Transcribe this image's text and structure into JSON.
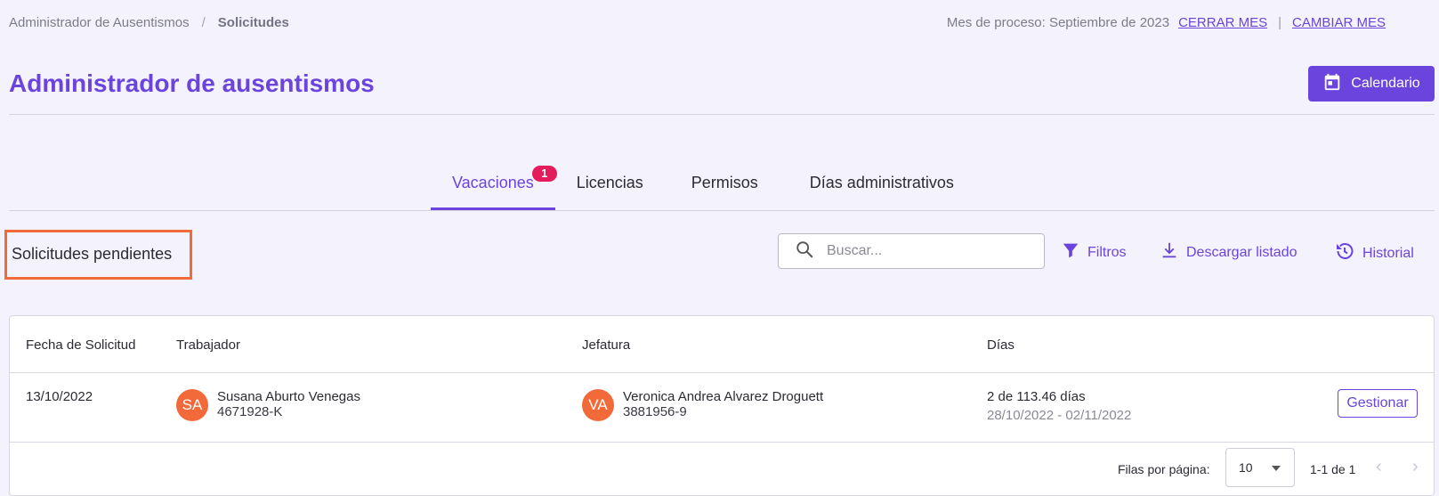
{
  "breadcrumb": {
    "parent": "Administrador de Ausentismos",
    "separator": "/",
    "current": "Solicitudes"
  },
  "process": {
    "label": "Mes de proceso: Septiembre de 2023",
    "close_month": "CERRAR MES",
    "change_month": "CAMBIAR MES"
  },
  "page": {
    "title": "Administrador de ausentismos",
    "calendar_button": "Calendario"
  },
  "tabs": [
    {
      "label": "Vacaciones",
      "badge": "1",
      "active": true
    },
    {
      "label": "Licencias"
    },
    {
      "label": "Permisos"
    },
    {
      "label": "Días administrativos"
    }
  ],
  "section": {
    "title": "Solicitudes pendientes"
  },
  "toolbar": {
    "search_placeholder": "Buscar...",
    "filters": "Filtros",
    "download": "Descargar listado",
    "history": "Historial"
  },
  "table": {
    "headers": [
      "Fecha de Solicitud",
      "Trabajador",
      "Jefatura",
      "Días"
    ],
    "rows": [
      {
        "date": "13/10/2022",
        "worker": {
          "initials": "SA",
          "name": "Susana Aburto Venegas",
          "id": "4671928-K"
        },
        "boss": {
          "initials": "VA",
          "name": "Veronica Andrea Alvarez Droguett",
          "id": "3881956-9"
        },
        "days": "2 de 113.46 días",
        "range": "28/10/2022 - 02/11/2022",
        "action": "Gestionar"
      }
    ]
  },
  "pagination": {
    "rows_per_page_label": "Filas por página:",
    "rows_per_page": "10",
    "range": "1-1 de 1"
  },
  "colors": {
    "accent": "#6a44dc",
    "badge": "#e41c5c",
    "avatar": "#f26a3a",
    "highlight": "#f26a3a"
  }
}
